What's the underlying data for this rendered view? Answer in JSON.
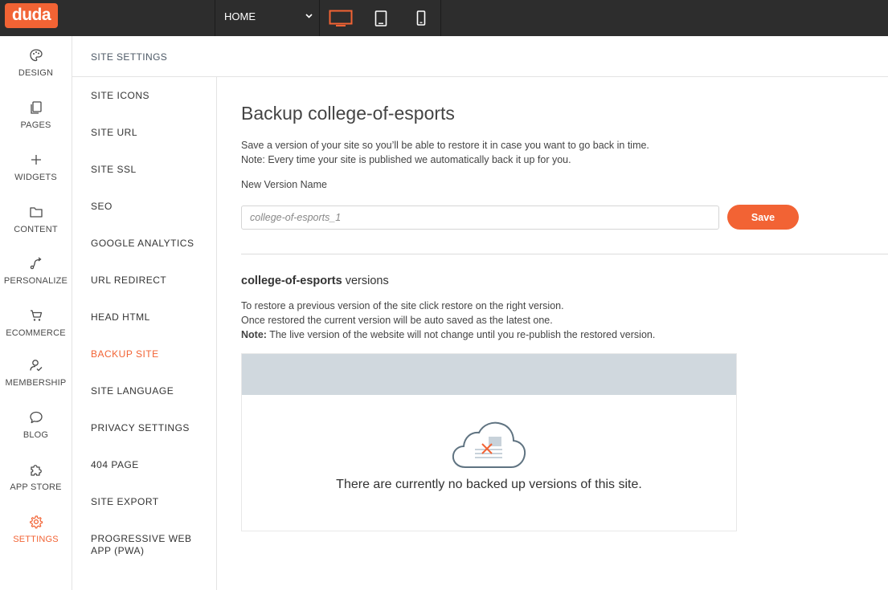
{
  "app": {
    "logo": "duda"
  },
  "topbar": {
    "page_select": "HOME",
    "devices": [
      {
        "name": "desktop",
        "active": true
      },
      {
        "name": "tablet",
        "active": false
      },
      {
        "name": "mobile",
        "active": false
      }
    ]
  },
  "rail": {
    "items": [
      {
        "label": "DESIGN",
        "icon": "palette-icon"
      },
      {
        "label": "PAGES",
        "icon": "pages-icon"
      },
      {
        "label": "WIDGETS",
        "icon": "plus-icon"
      },
      {
        "label": "CONTENT",
        "icon": "folder-icon"
      },
      {
        "label": "PERSONALIZE",
        "icon": "personalize-icon"
      },
      {
        "label": "ECOMMERCE",
        "icon": "cart-icon"
      },
      {
        "label": "MEMBERSHIP",
        "icon": "member-icon"
      },
      {
        "label": "BLOG",
        "icon": "chat-bubble-icon"
      },
      {
        "label": "APP STORE",
        "icon": "puzzle-icon"
      },
      {
        "label": "SETTINGS",
        "icon": "gear-icon",
        "active": true
      }
    ]
  },
  "settings": {
    "header": "SITE SETTINGS",
    "menu": [
      "SITE ICONS",
      "SITE URL",
      "SITE SSL",
      "SEO",
      "GOOGLE ANALYTICS",
      "URL REDIRECT",
      "HEAD HTML",
      "BACKUP SITE",
      "SITE LANGUAGE",
      "PRIVACY SETTINGS",
      "404 PAGE",
      "SITE EXPORT",
      "PROGRESSIVE WEB APP (PWA)"
    ],
    "active": "BACKUP SITE"
  },
  "main": {
    "title": "Backup college-of-esports",
    "desc_line1": "Save a version of your site so you’ll be able to restore it in case you want to go back in time.",
    "desc_line2": "Note: Every time your site is published we automatically back it up for you.",
    "field_label": "New Version Name",
    "input_placeholder": "college-of-esports_1",
    "save_label": "Save",
    "versions_site": "college-of-esports",
    "versions_suffix": " versions",
    "restore_line1": "To restore a previous version of the site click restore on the right version.",
    "restore_line2": "Once restored the current version will be auto saved as the latest one.",
    "note_label": "Note:",
    "note_text": " The live version of the website will not change until you re-publish the restored version.",
    "empty_text": "There are currently no backed up versions of this site."
  },
  "colors": {
    "accent": "#f26334",
    "topbar": "#2d2d2d",
    "table_header": "#d0d8de"
  }
}
